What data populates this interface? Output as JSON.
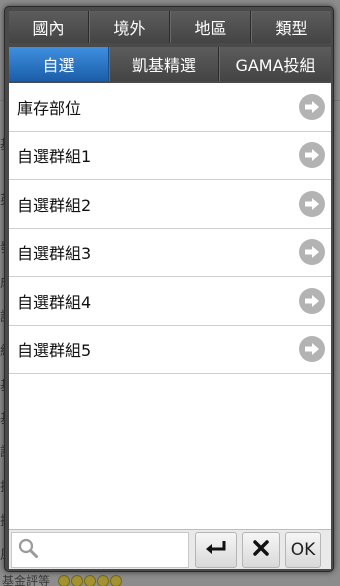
{
  "background": {
    "left_chars": [
      "基",
      "英",
      "發",
      "成",
      "詳",
      "紅",
      "基",
      "基",
      "詳",
      "投",
      "投",
      "風"
    ],
    "footer_label": "基金評等"
  },
  "top_tabs": [
    {
      "label": "國內"
    },
    {
      "label": "境外"
    },
    {
      "label": "地區"
    },
    {
      "label": "類型"
    }
  ],
  "sub_tabs": [
    {
      "label": "自選",
      "active": true
    },
    {
      "label": "凱基精選",
      "active": false
    },
    {
      "label": "GAMA投組",
      "active": false
    }
  ],
  "list": {
    "items": [
      {
        "label": "庫存部位",
        "icon": "arrow-right-icon"
      },
      {
        "label": "自選群組1",
        "icon": "arrow-right-icon"
      },
      {
        "label": "自選群組2",
        "icon": "arrow-right-icon"
      },
      {
        "label": "自選群組3",
        "icon": "arrow-right-icon"
      },
      {
        "label": "自選群組4",
        "icon": "arrow-right-icon"
      },
      {
        "label": "自選群組5",
        "icon": "arrow-right-icon"
      }
    ]
  },
  "toolbar": {
    "search_placeholder": "",
    "search_icon": "search-icon",
    "enter_icon": "enter-icon",
    "clear_icon": "close-icon",
    "ok_label": "OK"
  },
  "colors": {
    "active_tab": "#2a73c4",
    "tab": "#505050",
    "dialog": "#4a4a4a"
  }
}
